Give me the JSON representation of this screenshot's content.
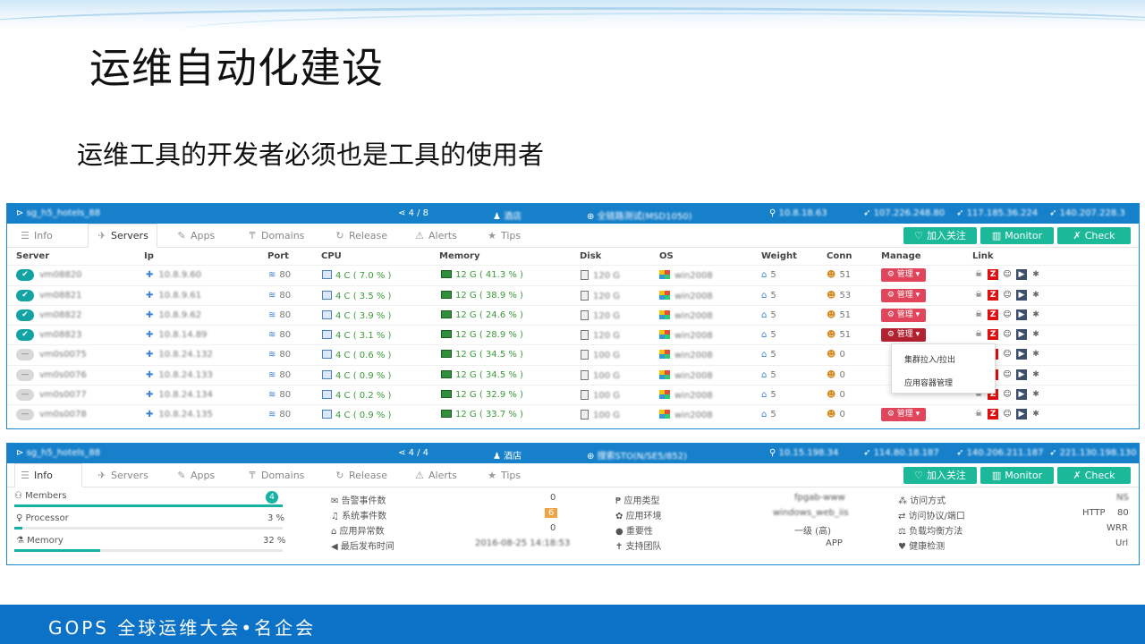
{
  "slide": {
    "title": "运维自动化建设",
    "subtitle": "运维工具的开发者必须也是工具的使用者",
    "footer": "GOPS 全球运维大会•名企会"
  },
  "panel1": {
    "bar": {
      "name": "sg_h5_hotels_88",
      "count": "4 / 8",
      "dept": "酒店",
      "env": "全链路测试(MSD1050)",
      "ip1": "10.8.18.63",
      "ip2": "107.226.248.80",
      "ip3": "117.185.36.224",
      "ip4": "140.207.228.3"
    },
    "tabs": [
      "Info",
      "Servers",
      "Apps",
      "Domains",
      "Release",
      "Alerts",
      "Tips"
    ],
    "buttons": {
      "follow": "加入关注",
      "monitor": "Monitor",
      "check": "Check"
    },
    "columns": [
      "Server",
      "Ip",
      "Port",
      "CPU",
      "Memory",
      "Disk",
      "OS",
      "Weight",
      "Conn",
      "Manage",
      "Link"
    ],
    "rows": [
      {
        "status": "on",
        "server": "vm08820",
        "ip": "10.8.9.60",
        "port": "80",
        "cpu": "4 C ( 7.0 % )",
        "mem": "12 G ( 41.3 % )",
        "disk": "120 G",
        "os": "win2008",
        "weight": "5",
        "conn": "51",
        "manage": "管理"
      },
      {
        "status": "on",
        "server": "vm08821",
        "ip": "10.8.9.61",
        "port": "80",
        "cpu": "4 C ( 3.5 % )",
        "mem": "12 G ( 38.9 % )",
        "disk": "120 G",
        "os": "win2008",
        "weight": "5",
        "conn": "53",
        "manage": "管理"
      },
      {
        "status": "on",
        "server": "vm08822",
        "ip": "10.8.9.62",
        "port": "80",
        "cpu": "4 C ( 3.9 % )",
        "mem": "12 G ( 24.6 % )",
        "disk": "120 G",
        "os": "win2008",
        "weight": "5",
        "conn": "51",
        "manage": "管理"
      },
      {
        "status": "on",
        "server": "vm08823",
        "ip": "10.8.14.89",
        "port": "80",
        "cpu": "4 C ( 3.1 % )",
        "mem": "12 G ( 28.9 % )",
        "disk": "120 G",
        "os": "win2008",
        "weight": "5",
        "conn": "51",
        "manage": "管理"
      },
      {
        "status": "off",
        "server": "vm0s0075",
        "ip": "10.8.24.132",
        "port": "80",
        "cpu": "4 C ( 0.6 % )",
        "mem": "12 G ( 34.5 % )",
        "disk": "100 G",
        "os": "win2008",
        "weight": "5",
        "conn": "0",
        "manage": ""
      },
      {
        "status": "off",
        "server": "vm0s0076",
        "ip": "10.8.24.133",
        "port": "80",
        "cpu": "4 C ( 0.9 % )",
        "mem": "12 G ( 34.5 % )",
        "disk": "100 G",
        "os": "win2008",
        "weight": "5",
        "conn": "0",
        "manage": ""
      },
      {
        "status": "off",
        "server": "vm0s0077",
        "ip": "10.8.24.134",
        "port": "80",
        "cpu": "4 C ( 0.2 % )",
        "mem": "12 G ( 32.9 % )",
        "disk": "100 G",
        "os": "win2008",
        "weight": "5",
        "conn": "0",
        "manage": ""
      },
      {
        "status": "off",
        "server": "vm0s0078",
        "ip": "10.8.24.135",
        "port": "80",
        "cpu": "4 C ( 0.9 % )",
        "mem": "12 G ( 33.7 % )",
        "disk": "100 G",
        "os": "win2008",
        "weight": "5",
        "conn": "0",
        "manage": "管理"
      }
    ],
    "dropdown": [
      "集群拉入/拉出",
      "应用容器管理"
    ]
  },
  "panel2": {
    "bar": {
      "name": "sg_h5_hotels_88",
      "count": "4 / 4",
      "dept": "酒店",
      "env": "搜索STO(N/SE5/852)",
      "ip1": "10.15.198.34",
      "ip2": "114.80.18.187",
      "ip3": "140.206.211.187",
      "ip4": "221.130.198.130"
    },
    "tabs": [
      "Info",
      "Servers",
      "Apps",
      "Domains",
      "Release",
      "Alerts",
      "Tips"
    ],
    "buttons": {
      "follow": "加入关注",
      "monitor": "Monitor",
      "check": "Check"
    },
    "stats": {
      "members_label": "Members",
      "members_value": "4",
      "processor_label": "Processor",
      "processor_value": "3 %",
      "processor_fill": 3,
      "memory_label": "Memory",
      "memory_value": "32 %",
      "memory_fill": 32
    },
    "col2": [
      {
        "label": "告警事件数",
        "value": "0"
      },
      {
        "label": "系统事件数",
        "value": "6"
      },
      {
        "label": "应用异常数",
        "value": "0"
      },
      {
        "label": "最后发布时间",
        "value": "2016-08-25 14:18:53"
      }
    ],
    "col3": [
      {
        "label": "应用类型",
        "value": "fpgab-www"
      },
      {
        "label": "应用环境",
        "value": "windows_web_iis"
      },
      {
        "label": "重要性",
        "value": "一级 (高)"
      },
      {
        "label": "支持团队",
        "value": "APP"
      }
    ],
    "col4": [
      {
        "label": "访问方式",
        "value": "NS"
      },
      {
        "label": "访问协议/端口",
        "value_a": "HTTP",
        "value_b": "80"
      },
      {
        "label": "负载均衡方法",
        "value": "WRR"
      },
      {
        "label": "健康检测",
        "value": "Url"
      }
    ]
  }
}
